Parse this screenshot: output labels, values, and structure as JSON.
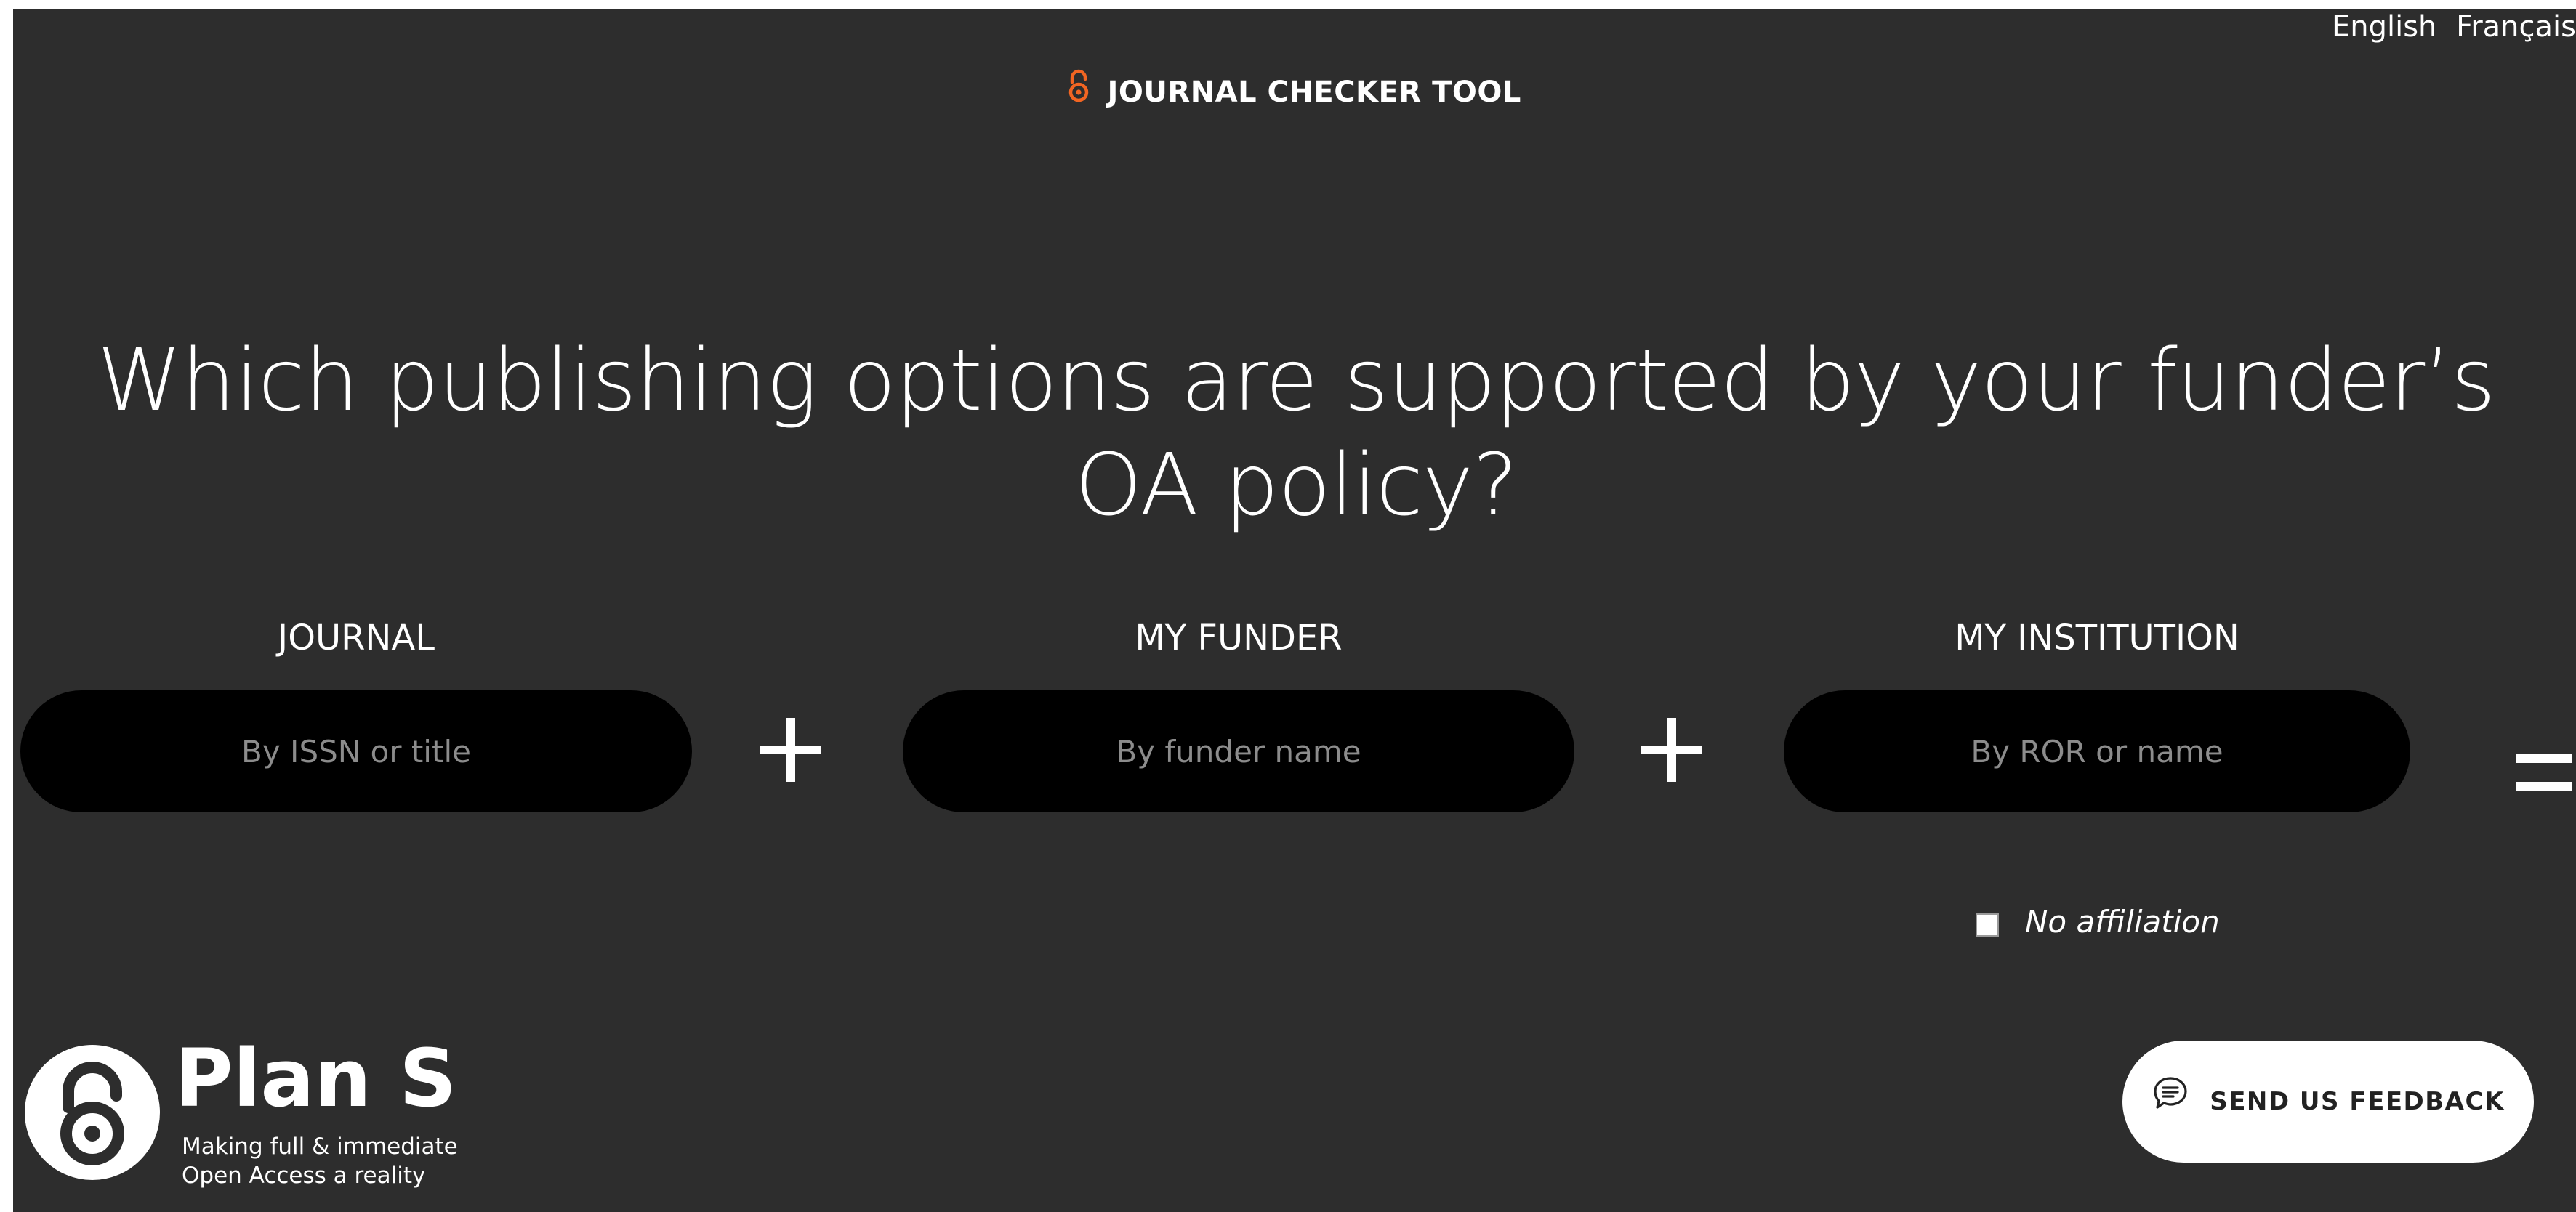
{
  "header": {
    "title": "JOURNAL CHECKER TOOL",
    "brand_icon": "open-access-lock-icon",
    "brand_color": "#f26522",
    "languages": [
      "English",
      "Français"
    ]
  },
  "headline": "Which publishing options are supported by your funder’s OA policy?",
  "form": {
    "journal": {
      "label": "JOURNAL",
      "placeholder": "By ISSN or title",
      "value": ""
    },
    "funder": {
      "label": "MY FUNDER",
      "placeholder": "By funder name",
      "value": ""
    },
    "institution": {
      "label": "MY INSTITUTION",
      "placeholder": "By ROR or name",
      "value": ""
    },
    "operators": [
      "plus-icon",
      "plus-icon",
      "equals-icon"
    ],
    "no_affiliation": {
      "label": "No affiliation",
      "checked": false
    }
  },
  "footer": {
    "logo_name": "Plan S",
    "tagline_line1": "Making full & immediate",
    "tagline_line2": "Open Access a reality",
    "logo_icon": "open-access-logo-icon",
    "feedback_label": "SEND US FEEDBACK",
    "feedback_icon": "chat-bubble-icon"
  },
  "colors": {
    "background": "#2d2d2d",
    "input_background": "#000000",
    "placeholder": "#8c8c8c",
    "text": "#ffffff"
  }
}
